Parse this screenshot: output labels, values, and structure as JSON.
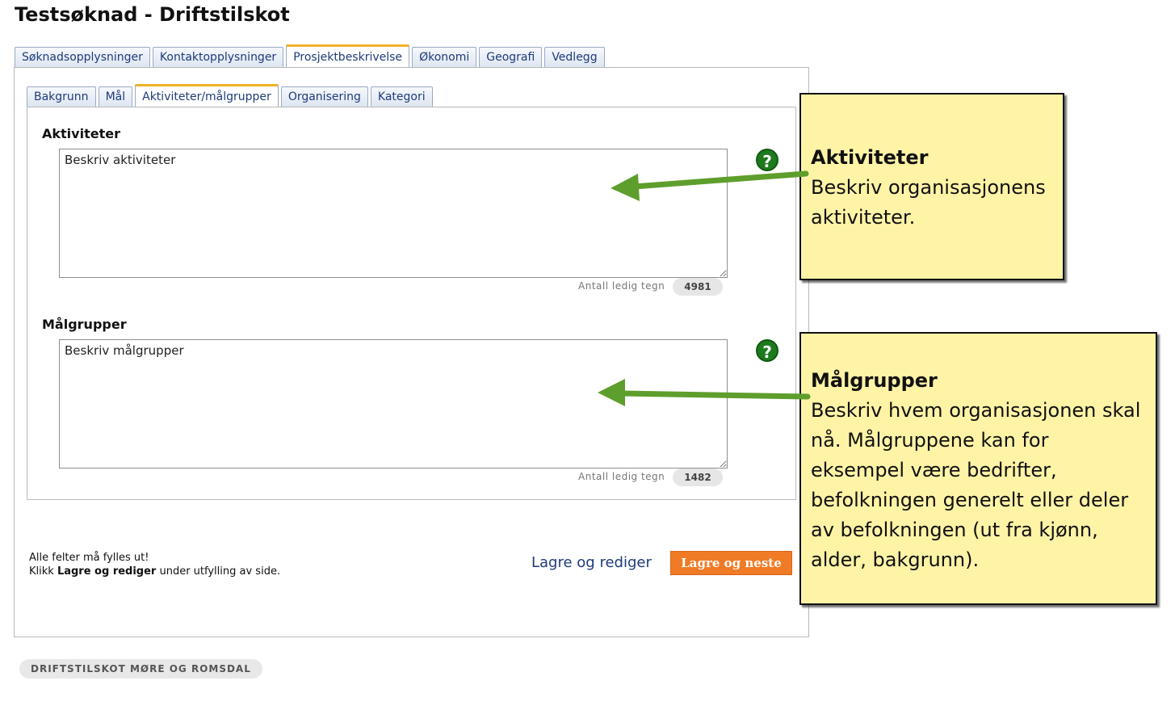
{
  "page": {
    "title": "Testsøknad - Driftstilskot"
  },
  "main_tabs": [
    {
      "label": "Søknadsopplysninger"
    },
    {
      "label": "Kontaktopplysninger"
    },
    {
      "label": "Prosjektbeskrivelse",
      "active": true
    },
    {
      "label": "Økonomi"
    },
    {
      "label": "Geografi"
    },
    {
      "label": "Vedlegg"
    }
  ],
  "sub_tabs": [
    {
      "label": "Bakgrunn"
    },
    {
      "label": "Mål"
    },
    {
      "label": "Aktiviteter/målgrupper",
      "active": true
    },
    {
      "label": "Organisering"
    },
    {
      "label": "Kategori"
    }
  ],
  "fields": {
    "activities": {
      "label": "Aktiviteter",
      "value": "Beskriv aktiviteter",
      "chars_label": "Antall ledig tegn",
      "chars_left": "4981"
    },
    "target_groups": {
      "label": "Målgrupper",
      "value": "Beskriv målgrupper",
      "chars_label": "Antall ledig tegn",
      "chars_left": "1482"
    }
  },
  "help_icon_glyph": "?",
  "footer_note": {
    "line1": "Alle felter må fylles ut!",
    "line2_prefix": "Klikk ",
    "line2_bold": "Lagre og rediger",
    "line2_suffix": " under utfylling av side."
  },
  "actions": {
    "save_edit": "Lagre og rediger",
    "save_next": "Lagre og neste"
  },
  "footer_badge": "DRIFTSTILSKOT MØRE OG ROMSDAL",
  "callouts": {
    "activities": {
      "title": "Aktiviteter",
      "lines": [
        "Beskriv organisasjonens",
        "aktiviteter."
      ]
    },
    "target_groups": {
      "title": "Målgrupper",
      "lines": [
        "Beskriv hvem organisasjonen skal",
        "nå. Målgruppene kan for",
        "eksempel være bedrifter,",
        "befolkningen generelt eller deler",
        "av befolkningen (ut fra kjønn,",
        "alder, bakgrunn)."
      ]
    }
  },
  "colors": {
    "tab_active_accent": "#f0b129",
    "link": "#1f3b7a",
    "primary_button": "#f07b26",
    "help_icon": "#1e7a1e",
    "callout_bg": "#fff3a6",
    "arrow": "#5e9e2c"
  }
}
